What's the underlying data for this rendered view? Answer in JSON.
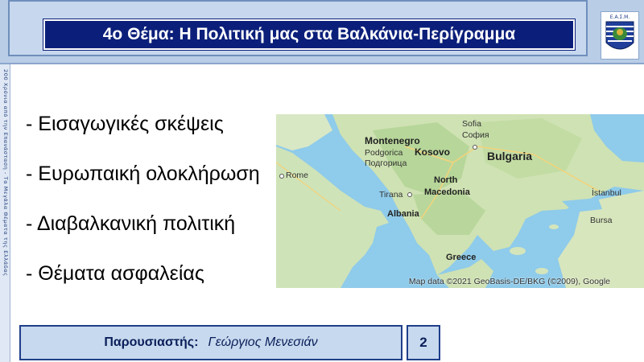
{
  "header": {
    "title": "4ο Θέμα: Η Πολιτική μας στα Βαλκάνια-Περίγραμμα",
    "logo_text": "Ε.Α.Σ.Μ."
  },
  "side_strip": {
    "text": "200 Χρόνια από την Επανάσταση - Τα Μεγάλα Θέματα της Ελλάδας"
  },
  "bullets": [
    "- Εισαγωγικές σκέψεις",
    "- Ευρωπαική ολοκλήρωση",
    "- Διαβαλκανική πολιτική",
    "- Θέματα ασφαλείας"
  ],
  "map": {
    "labels": {
      "sofia": "Sofia",
      "sofia_local": "София",
      "montenegro": "Montenegro",
      "podgorica": "Podgorica",
      "podgorica_local": "Подгорица",
      "kosovo": "Kosovo",
      "bulgaria": "Bulgaria",
      "rome": "Rome",
      "north": "North",
      "macedonia": "Macedonia",
      "tirana": "Tirana",
      "albania": "Albania",
      "istanbul": "İstanbul",
      "bursa": "Bursa",
      "greece": "Greece"
    },
    "credit": "Map data ©2021 GeoBasis-DE/BKG (©2009), Google"
  },
  "footer": {
    "presenter_label": "Παρουσιαστής:",
    "presenter_name": "Γεώργιος Μενεσιάν",
    "page_number": "2"
  }
}
